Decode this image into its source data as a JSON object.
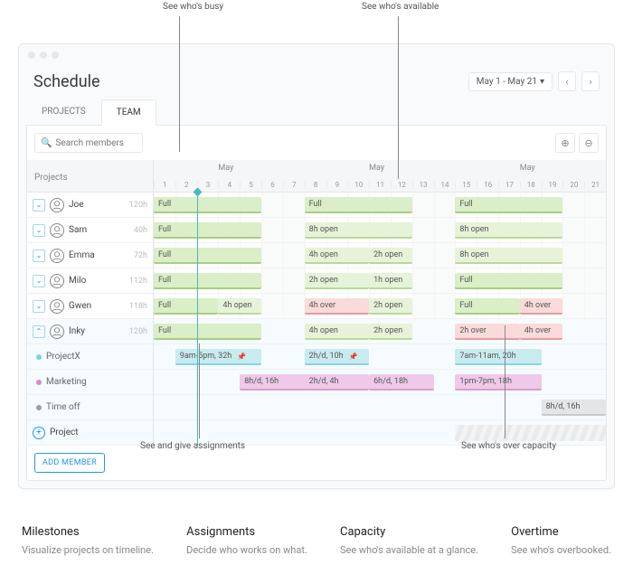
{
  "annotations": {
    "busy": "See who's busy",
    "available": "See who's available",
    "assignments_note": "See and give assignments",
    "overcapacity": "See who's over capacity"
  },
  "window": {
    "title": "Schedule",
    "date_range": "May 1 - May 21",
    "tabs": {
      "projects": "PROJECTS",
      "team": "TEAM"
    }
  },
  "toolbar": {
    "search_placeholder": "Search members",
    "projects_header": "Projects",
    "add_member": "ADD MEMBER",
    "add_project": "Project"
  },
  "timeline": {
    "months": [
      "May",
      "May",
      "May"
    ],
    "days": [
      "1",
      "2",
      "3",
      "4",
      "5",
      "6",
      "7",
      "8",
      "9",
      "10",
      "11",
      "12",
      "13",
      "14",
      "15",
      "16",
      "17",
      "18",
      "19",
      "20",
      "21"
    ]
  },
  "members": [
    {
      "name": "Joe",
      "hours": "120h"
    },
    {
      "name": "Sam",
      "hours": "40h"
    },
    {
      "name": "Emma",
      "hours": "72h"
    },
    {
      "name": "Milo",
      "hours": "112h"
    },
    {
      "name": "Gwen",
      "hours": "118h"
    },
    {
      "name": "Inky",
      "hours": "120h"
    }
  ],
  "projects": [
    {
      "name": "ProjectX",
      "color": "#7bd3de"
    },
    {
      "name": "Marketing",
      "color": "#d48cc9"
    },
    {
      "name": "Time off",
      "color": "#9aa0a6"
    }
  ],
  "bars": {
    "joe": [
      {
        "c": "green",
        "a": 0,
        "b": 5,
        "t": "Full"
      },
      {
        "c": "green",
        "a": 7,
        "b": 12,
        "t": "Full"
      },
      {
        "c": "green",
        "a": 14,
        "b": 19,
        "t": "Full"
      }
    ],
    "sam": [
      {
        "c": "green",
        "a": 0,
        "b": 5,
        "t": "Full"
      },
      {
        "c": "green-light",
        "a": 7,
        "b": 12,
        "t": "8h open"
      },
      {
        "c": "green-light",
        "a": 14,
        "b": 19,
        "t": "8h open"
      }
    ],
    "emma": [
      {
        "c": "green",
        "a": 0,
        "b": 5,
        "t": "Full"
      },
      {
        "c": "green-light",
        "a": 7,
        "b": 10,
        "t": "4h open"
      },
      {
        "c": "green-light",
        "a": 10,
        "b": 12,
        "t": "2h open"
      },
      {
        "c": "green-light",
        "a": 14,
        "b": 19,
        "t": "8h open"
      }
    ],
    "milo": [
      {
        "c": "green",
        "a": 0,
        "b": 5,
        "t": "Full"
      },
      {
        "c": "green-light",
        "a": 7,
        "b": 10,
        "t": "2h open"
      },
      {
        "c": "green-light",
        "a": 10,
        "b": 12,
        "t": "1h open"
      },
      {
        "c": "green",
        "a": 14,
        "b": 19,
        "t": "Full"
      }
    ],
    "gwen": [
      {
        "c": "green",
        "a": 0,
        "b": 3,
        "t": "Full"
      },
      {
        "c": "green-light",
        "a": 3,
        "b": 5,
        "t": "4h open"
      },
      {
        "c": "red",
        "a": 7,
        "b": 10,
        "t": "4h over"
      },
      {
        "c": "green-light",
        "a": 10,
        "b": 12,
        "t": "2h open"
      },
      {
        "c": "green",
        "a": 14,
        "b": 17,
        "t": "Full"
      },
      {
        "c": "red",
        "a": 17,
        "b": 19,
        "t": "4h over"
      }
    ],
    "inky": [
      {
        "c": "green",
        "a": 0,
        "b": 5,
        "t": "Full"
      },
      {
        "c": "green-light",
        "a": 7,
        "b": 10,
        "t": "4h open"
      },
      {
        "c": "green-light",
        "a": 10,
        "b": 12,
        "t": "2h open"
      },
      {
        "c": "red",
        "a": 14,
        "b": 17,
        "t": "2h over"
      },
      {
        "c": "red",
        "a": 17,
        "b": 19,
        "t": "4h over"
      }
    ],
    "px": [
      {
        "c": "cyan",
        "a": 1,
        "b": 5,
        "t": "9am-5pm, 32h",
        "pin": true
      },
      {
        "c": "cyan",
        "a": 7,
        "b": 10,
        "t": "2h/d, 10h",
        "pin": true
      },
      {
        "c": "cyan",
        "a": 14,
        "b": 18,
        "t": "7am-11am, 20h"
      }
    ],
    "mkt": [
      {
        "c": "pink",
        "a": 4,
        "b": 8,
        "t": "8h/d, 16h"
      },
      {
        "c": "pink",
        "a": 7,
        "b": 10,
        "t": "2h/d, 4h"
      },
      {
        "c": "pink",
        "a": 10,
        "b": 13,
        "t": "6h/d, 18h"
      },
      {
        "c": "pink",
        "a": 14,
        "b": 18,
        "t": "1pm-7pm, 18h"
      }
    ],
    "off": [
      {
        "c": "gray",
        "a": 18,
        "b": 21,
        "t": "8h/d, 16h"
      }
    ],
    "addrow": [
      {
        "c": "dashed",
        "a": 14,
        "b": 21,
        "t": ""
      }
    ]
  },
  "features": [
    {
      "title": "Milestones",
      "desc": "Visualize projects on timeline."
    },
    {
      "title": "Assignments",
      "desc": "Decide who works on what."
    },
    {
      "title": "Capacity",
      "desc": "See who's available at a glance."
    },
    {
      "title": "Overtime",
      "desc": "See who's overbooked."
    }
  ]
}
